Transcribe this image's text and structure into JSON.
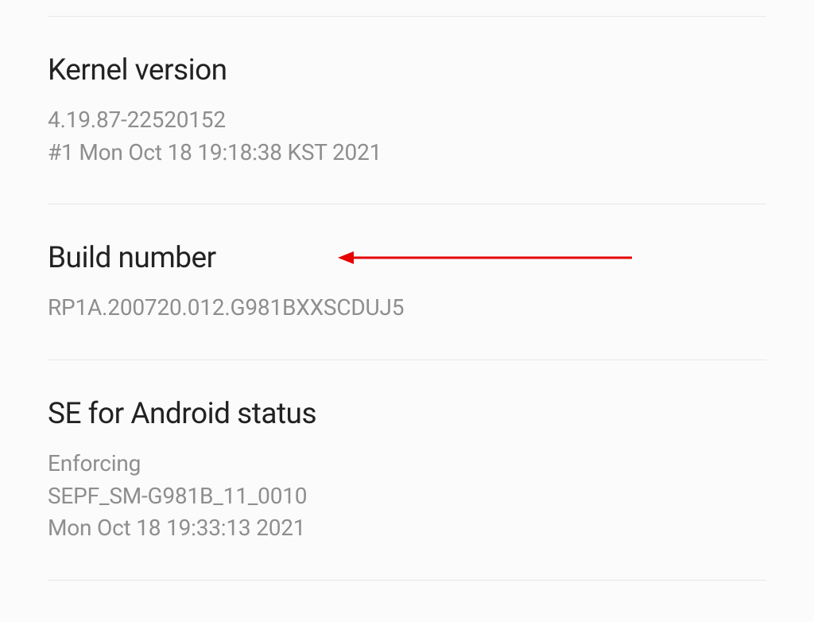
{
  "sections": {
    "kernel": {
      "title": "Kernel version",
      "line1": "4.19.87-22520152",
      "line2": "#1 Mon Oct 18 19:18:38 KST 2021"
    },
    "build": {
      "title": "Build number",
      "value": "RP1A.200720.012.G981BXXSCDUJ5"
    },
    "se": {
      "title": "SE for Android status",
      "line1": "Enforcing",
      "line2": "SEPF_SM-G981B_11_0010",
      "line3": "Mon Oct 18 19:33:13 2021"
    }
  }
}
